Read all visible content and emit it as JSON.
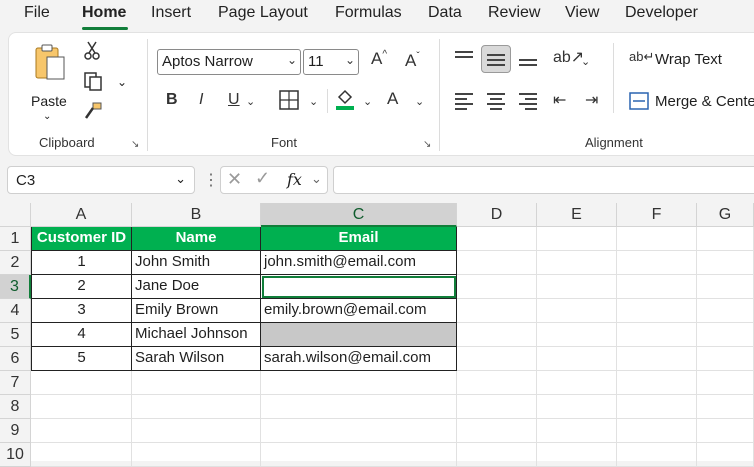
{
  "menu": [
    "File",
    "Home",
    "Insert",
    "Page Layout",
    "Formulas",
    "Data",
    "Review",
    "View",
    "Developer"
  ],
  "menu_active": "Home",
  "ribbon": {
    "clipboard": {
      "label": "Clipboard",
      "paste_label": "Paste",
      "paste_icon": "clipboard-icon",
      "cut_icon": "scissors-icon",
      "copy_icon": "copy-icon",
      "format_painter_icon": "paintbrush-icon"
    },
    "font": {
      "label": "Font",
      "font_name": "Aptos Narrow",
      "font_size": "11",
      "bold": "B",
      "italic": "I",
      "underline": "U",
      "grow": "A^",
      "shrink": "Aˇ",
      "font_color_glyph": "A"
    },
    "alignment": {
      "label": "Alignment",
      "wrap_text": "Wrap Text",
      "merge_center": "Merge & Center"
    }
  },
  "formula_bar": {
    "name_box": "C3",
    "fx": "fx",
    "formula": ""
  },
  "columns": [
    "A",
    "B",
    "C",
    "D",
    "E",
    "F",
    "G"
  ],
  "rows": [
    "1",
    "2",
    "3",
    "4",
    "5",
    "6",
    "7",
    "8",
    "9",
    "10"
  ],
  "selected": {
    "column": "C",
    "row": "3"
  },
  "table": {
    "headers": [
      "Customer ID",
      "Name",
      "Email"
    ],
    "header_color": "#00B050",
    "rows": [
      [
        "1",
        "John Smith",
        "john.smith@email.com"
      ],
      [
        "2",
        "Jane Doe",
        ""
      ],
      [
        "3",
        "Emily Brown",
        "emily.brown@email.com"
      ],
      [
        "4",
        "Michael Johnson",
        ""
      ],
      [
        "5",
        "Sarah Wilson",
        "sarah.wilson@email.com"
      ]
    ],
    "gray_fill_color": "#C8C8C8"
  }
}
